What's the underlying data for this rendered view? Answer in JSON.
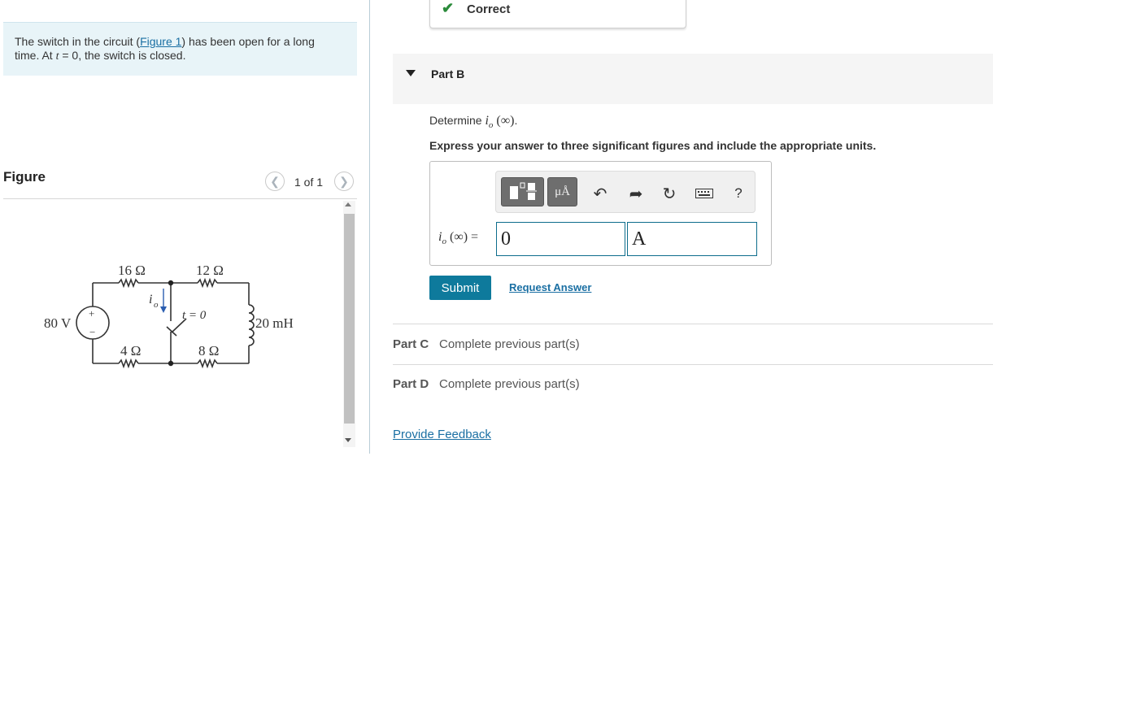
{
  "problem": {
    "text_before_link": "The switch in the circuit (",
    "figure_link": "Figure 1",
    "text_after_link": ") has been open for a long time. At ",
    "time_var": "t",
    "text_end": " = 0, the switch is closed."
  },
  "figure": {
    "title": "Figure",
    "counter": "1 of 1",
    "prev_icon": "chevron-left-icon",
    "next_icon": "chevron-right-icon",
    "circuit_labels": {
      "source": "80 V",
      "r1": "16 Ω",
      "r2": "12 Ω",
      "r3": "4 Ω",
      "r4": "8 Ω",
      "inductor": "20 mH",
      "current": "i",
      "current_sub": "o",
      "switch_time": "t = 0",
      "plus": "+",
      "minus": "−"
    }
  },
  "status": {
    "icon": "check-icon",
    "text": "Correct",
    "color": "#2a8a3a"
  },
  "part_b": {
    "label": "Part B",
    "determine_prefix": "Determine ",
    "determine_var": "i",
    "determine_sub": "o",
    "determine_arg": " (∞)",
    "determine_end": ".",
    "instructions": "Express your answer to three significant figures and include the appropriate units.",
    "eq_var": "i",
    "eq_sub": "o",
    "eq_arg": " (∞) =",
    "value": "0",
    "units": "A",
    "toolbar": {
      "templates_icon": "templates-icon",
      "units_label": "μÅ",
      "undo_icon": "undo-icon",
      "redo_icon": "redo-icon",
      "reset_icon": "reset-icon",
      "keyboard_icon": "keyboard-icon",
      "help_label": "?"
    },
    "submit": "Submit",
    "request_answer": "Request Answer"
  },
  "part_c": {
    "label": "Part C",
    "status": "Complete previous part(s)"
  },
  "part_d": {
    "label": "Part D",
    "status": "Complete previous part(s)"
  },
  "feedback": "Provide Feedback",
  "colors": {
    "accent": "#0e7a9c",
    "link": "#1a6fa3",
    "problem_bg": "#e8f4f8"
  }
}
